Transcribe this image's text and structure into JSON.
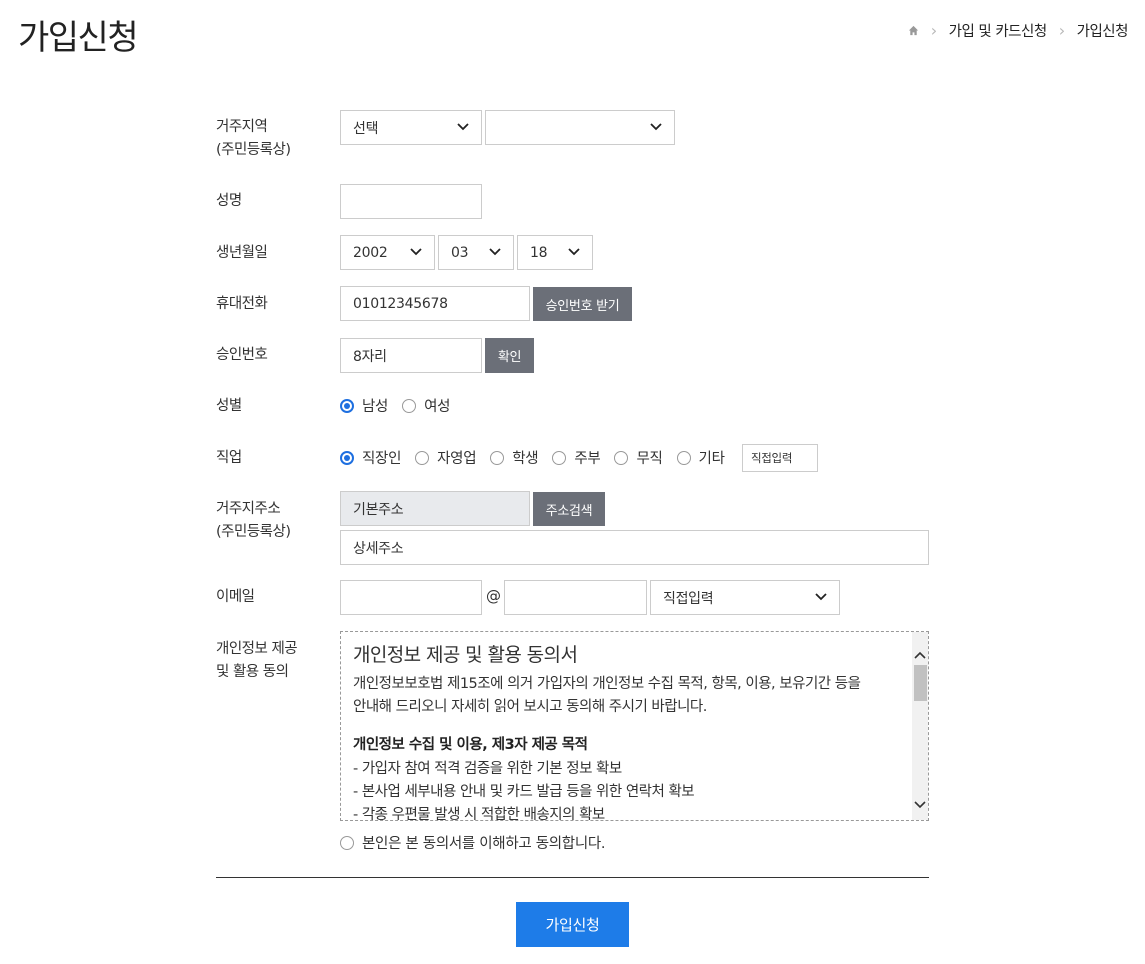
{
  "header": {
    "title": "가입신청",
    "breadcrumb": [
      "가입 및 카드신청",
      "가입신청"
    ]
  },
  "form": {
    "region": {
      "label_line1": "거주지역",
      "label_line2": "(주민등록상)",
      "select1": "선택",
      "select2": ""
    },
    "name": {
      "label": "성명",
      "value": ""
    },
    "birth": {
      "label": "생년월일",
      "year": "2002",
      "month": "03",
      "day": "18"
    },
    "phone": {
      "label": "휴대전화",
      "value": "01012345678",
      "button": "승인번호 받기"
    },
    "auth": {
      "label": "승인번호",
      "placeholder": "8자리",
      "button": "확인"
    },
    "gender": {
      "label": "성별",
      "options": [
        "남성",
        "여성"
      ],
      "selected": "남성"
    },
    "job": {
      "label": "직업",
      "options": [
        "직장인",
        "자영업",
        "학생",
        "주부",
        "무직",
        "기타"
      ],
      "selected": "직장인",
      "other_placeholder": "직접입력"
    },
    "address": {
      "label_line1": "거주지주소",
      "label_line2": "(주민등록상)",
      "base_placeholder": "기본주소",
      "search_button": "주소검색",
      "detail_placeholder": "상세주소"
    },
    "email": {
      "label": "이메일",
      "local": "",
      "at": "@",
      "domain": "",
      "domain_select": "직접입력"
    },
    "consent": {
      "label_line1": "개인정보 제공",
      "label_line2": "및 활용 동의",
      "title": "개인정보 제공 및 활용 동의서",
      "intro_line1": "개인정보보호법 제15조에 의거 가입자의 개인정보 수집 목적, 항목, 이용, 보유기간 등을",
      "intro_line2": "안내해 드리오니 자세히 읽어 보시고 동의해 주시기 바랍니다.",
      "section_title": "개인정보 수집 및 이용, 제3자 제공 목적",
      "items": [
        "- 가입자 참여 적격 검증을 위한 기본 정보 확보",
        "- 본사업 세부내용 안내 및 카드 발급 등을 위한 연락처 확보",
        "- 각종 우편물 발생 시 적합한 배송지의 확보"
      ],
      "agree_label": "본인은 본 동의서를 이해하고 동의합니다."
    }
  },
  "submit_label": "가입신청",
  "colors": {
    "primary": "#1e7ce8",
    "dark_button": "#6b6f78",
    "radio_on": "#1e6fe0"
  }
}
